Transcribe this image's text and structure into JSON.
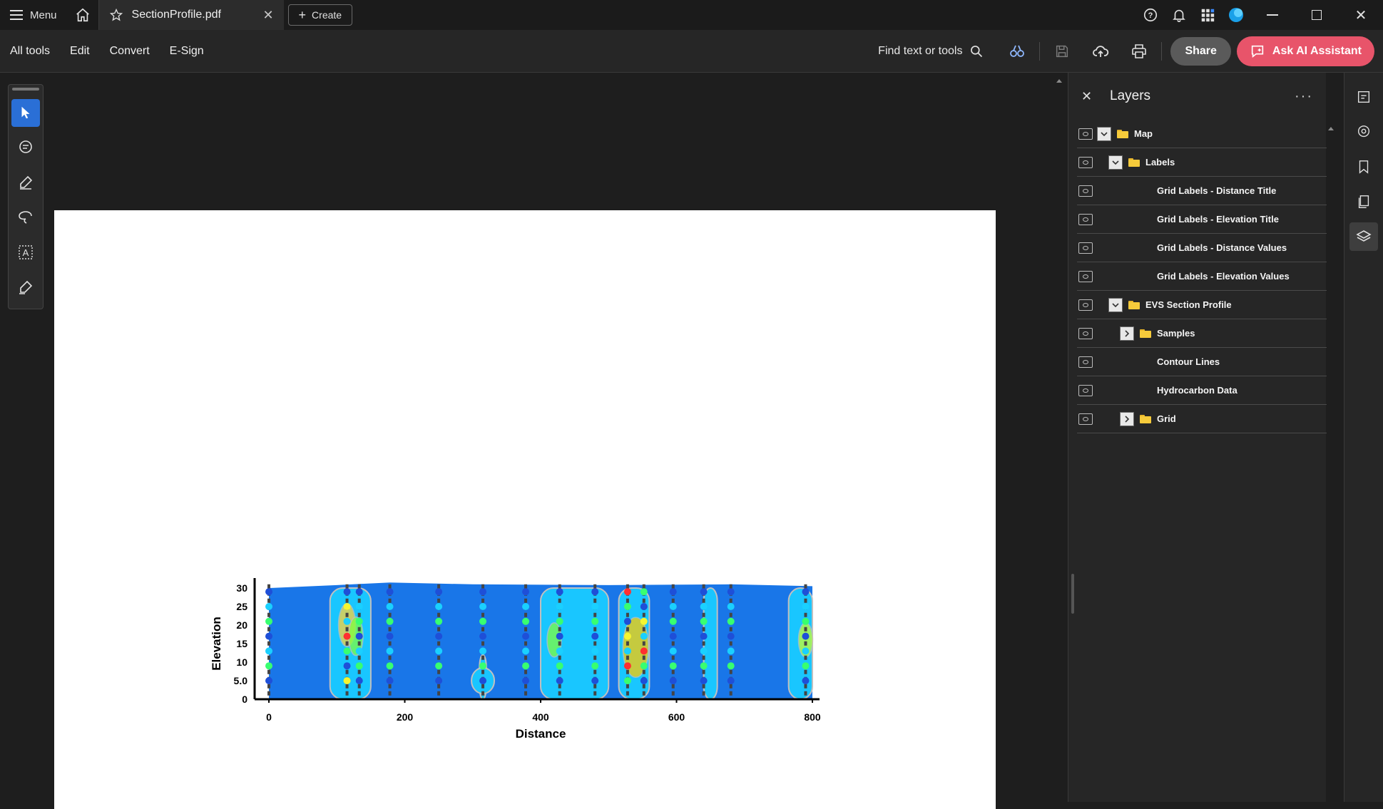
{
  "titlebar": {
    "menu_label": "Menu",
    "tab_title": "SectionProfile.pdf",
    "create_label": "Create"
  },
  "toolbar": {
    "menus": [
      "All tools",
      "Edit",
      "Convert",
      "E-Sign"
    ],
    "find_label": "Find text or tools",
    "share_label": "Share",
    "ai_label": "Ask AI Assistant"
  },
  "left_tools": [
    "select-arrow-icon",
    "comment-icon",
    "highlight-pen-icon",
    "lasso-icon",
    "text-box-icon",
    "sign-icon"
  ],
  "panel": {
    "title": "Layers",
    "layers": [
      {
        "label": "Map",
        "toggle": "expanded",
        "folder": true,
        "indent": 0
      },
      {
        "label": "Labels",
        "toggle": "expanded",
        "folder": true,
        "indent": 1
      },
      {
        "label": "Grid Labels - Distance Title",
        "toggle": "none",
        "folder": false,
        "indent": 2
      },
      {
        "label": "Grid Labels - Elevation Title",
        "toggle": "none",
        "folder": false,
        "indent": 2
      },
      {
        "label": "Grid Labels - Distance Values",
        "toggle": "none",
        "folder": false,
        "indent": 2
      },
      {
        "label": "Grid Labels - Elevation Values",
        "toggle": "none",
        "folder": false,
        "indent": 2
      },
      {
        "label": "EVS Section Profile",
        "toggle": "expanded",
        "folder": true,
        "indent": 1
      },
      {
        "label": "Samples",
        "toggle": "collapsed",
        "folder": true,
        "indent": 2
      },
      {
        "label": "Contour Lines",
        "toggle": "none",
        "folder": false,
        "indent": 2
      },
      {
        "label": "Hydrocarbon Data",
        "toggle": "none",
        "folder": false,
        "indent": 2
      },
      {
        "label": "Grid",
        "toggle": "collapsed",
        "folder": true,
        "indent": 2
      }
    ]
  },
  "chart_data": {
    "type": "heatmap",
    "xlabel": "Distance",
    "ylabel": "Elevation",
    "x_ticks": [
      "0",
      "200",
      "400",
      "600",
      "800"
    ],
    "y_ticks": [
      "0",
      "5.0",
      "10",
      "15",
      "20",
      "25",
      "30"
    ],
    "xlim": [
      0,
      800
    ],
    "ylim": [
      0,
      30
    ],
    "boreholes": [
      0,
      115,
      133,
      178,
      250,
      315,
      378,
      428,
      480,
      528,
      552,
      595,
      640,
      680,
      790
    ],
    "colors": {
      "background": "#1976e8",
      "mid": "#19c6ff",
      "contour": "#c0c0c0",
      "high": "#ff2020"
    }
  }
}
